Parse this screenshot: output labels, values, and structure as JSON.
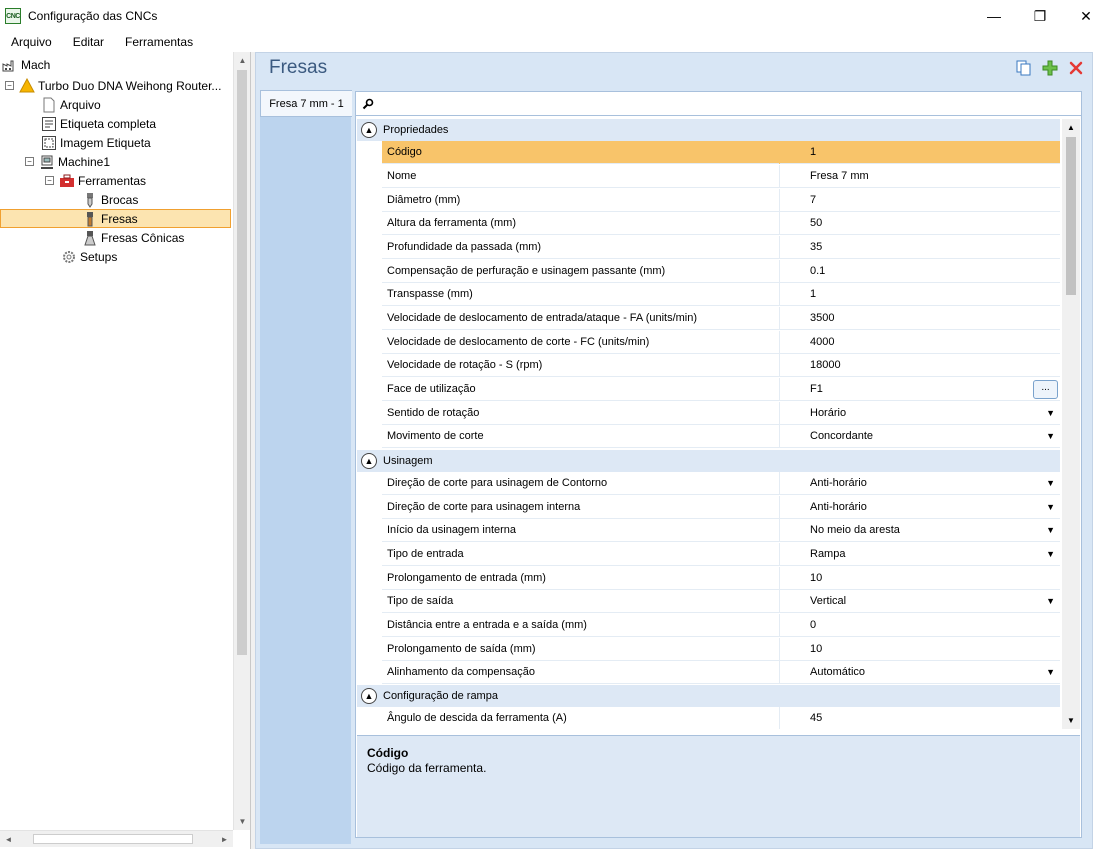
{
  "window": {
    "title": "Configuração das CNCs",
    "app_icon_text": "CNC",
    "minimize_glyph": "—",
    "restore_glyph": "❐",
    "close_glyph": "✕"
  },
  "menu": {
    "items": [
      "Arquivo",
      "Editar",
      "Ferramentas"
    ]
  },
  "tree": {
    "root": "Mach",
    "machine_group": "Turbo Duo DNA Weihong Router...",
    "arquivo": "Arquivo",
    "etiqueta_completa": "Etiqueta completa",
    "imagem_etiqueta": "Imagem Etiqueta",
    "machine": "Machine1",
    "ferramentas": "Ferramentas",
    "brocas": "Brocas",
    "fresas": "Fresas",
    "fresas_conicas": "Fresas Cônicas",
    "setups": "Setups",
    "expand_minus": "−"
  },
  "main": {
    "title": "Fresas",
    "tool_tab": "Fresa 7 mm - 1",
    "search_placeholder": ""
  },
  "categories": {
    "propriedades": "Propriedades",
    "usinagem": "Usinagem",
    "rampa": "Configuração de rampa"
  },
  "properties": [
    {
      "name": "Código",
      "value": "1"
    },
    {
      "name": "Nome",
      "value": "Fresa 7 mm"
    },
    {
      "name": "Diâmetro (mm)",
      "value": "7"
    },
    {
      "name": "Altura da ferramenta (mm)",
      "value": "50"
    },
    {
      "name": "Profundidade da passada (mm)",
      "value": "35"
    },
    {
      "name": "Compensação de perfuração e usinagem passante (mm)",
      "value": "0.1"
    },
    {
      "name": "Transpasse (mm)",
      "value": "1"
    },
    {
      "name": "Velocidade de deslocamento de entrada/ataque - FA (units/min)",
      "value": "3500"
    },
    {
      "name": "Velocidade de deslocamento de corte - FC (units/min)",
      "value": "4000"
    },
    {
      "name": "Velocidade de rotação - S (rpm)",
      "value": "18000"
    },
    {
      "name": "Face de utilização",
      "value": "F1",
      "button": "..."
    },
    {
      "name": "Sentido de rotação",
      "value": "Horário"
    },
    {
      "name": "Movimento de corte",
      "value": "Concordante"
    }
  ],
  "usinagem": [
    {
      "name": "Direção de corte para usinagem de Contorno",
      "value": "Anti-horário"
    },
    {
      "name": "Direção de corte para usinagem interna",
      "value": "Anti-horário"
    },
    {
      "name": "Início da usinagem interna",
      "value": "No meio da aresta"
    },
    {
      "name": "Tipo de entrada",
      "value": "Rampa"
    },
    {
      "name": "Prolongamento de entrada (mm)",
      "value": "10"
    },
    {
      "name": "Tipo de saída",
      "value": "Vertical"
    },
    {
      "name": "Distância entre a entrada e a saída (mm)",
      "value": "0"
    },
    {
      "name": "Prolongamento de saída (mm)",
      "value": "10"
    },
    {
      "name": "Alinhamento da compensação",
      "value": "Automático"
    }
  ],
  "rampa": [
    {
      "name": "Ângulo de descida da ferramenta (A)",
      "value": "45"
    }
  ],
  "help": {
    "title": "Código",
    "text": "Código da ferramenta."
  },
  "colors": {
    "selection": "#f8c46a",
    "panel_bg": "#d8e6f5",
    "category_bg": "#dde8f5",
    "title_blue": "#3b5a80"
  }
}
